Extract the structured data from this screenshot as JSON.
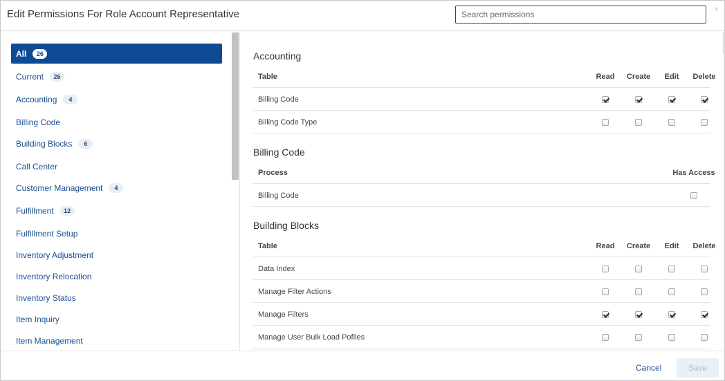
{
  "header": {
    "title": "Edit Permissions For Role Account Representative",
    "search_placeholder": "Search permissions",
    "search_value": "",
    "close_glyph": "×"
  },
  "sidebar": {
    "items": [
      {
        "label": "All",
        "count": "26",
        "active": true
      },
      {
        "label": "Current",
        "count": "26"
      },
      {
        "label": "Accounting",
        "count": "4"
      },
      {
        "label": "Billing Code",
        "count": ""
      },
      {
        "label": "Building Blocks",
        "count": "6"
      },
      {
        "label": "Call Center",
        "count": ""
      },
      {
        "label": "Customer Management",
        "count": "4"
      },
      {
        "label": "Fulfillment",
        "count": "12"
      },
      {
        "label": "Fulfillment Setup",
        "count": ""
      },
      {
        "label": "Inventory Adjustment",
        "count": ""
      },
      {
        "label": "Inventory Relocation",
        "count": ""
      },
      {
        "label": "Inventory Status",
        "count": ""
      },
      {
        "label": "Item Inquiry",
        "count": ""
      },
      {
        "label": "Item Management",
        "count": ""
      }
    ]
  },
  "sections": [
    {
      "title": "Accounting",
      "kind": "table",
      "headers": {
        "name": "Table",
        "read": "Read",
        "create": "Create",
        "edit": "Edit",
        "delete": "Delete"
      },
      "rows": [
        {
          "name": "Billing Code",
          "read": true,
          "create": true,
          "edit": true,
          "delete": true
        },
        {
          "name": "Billing Code Type",
          "read": false,
          "create": false,
          "edit": false,
          "delete": false
        }
      ]
    },
    {
      "title": "Billing Code",
      "kind": "process",
      "headers": {
        "name": "Process",
        "access": "Has Access"
      },
      "rows": [
        {
          "name": "Billing Code",
          "access": false
        }
      ]
    },
    {
      "title": "Building Blocks",
      "kind": "table",
      "headers": {
        "name": "Table",
        "read": "Read",
        "create": "Create",
        "edit": "Edit",
        "delete": "Delete"
      },
      "rows": [
        {
          "name": "Data Index",
          "read": false,
          "create": false,
          "edit": false,
          "delete": false
        },
        {
          "name": "Manage Filter Actions",
          "read": false,
          "create": false,
          "edit": false,
          "delete": false
        },
        {
          "name": "Manage Filters",
          "read": true,
          "create": true,
          "edit": true,
          "delete": true
        },
        {
          "name": "Manage User Bulk Load Pofiles",
          "read": false,
          "create": false,
          "edit": false,
          "delete": false
        }
      ]
    }
  ],
  "footer": {
    "cancel_label": "Cancel",
    "save_label": "Save"
  },
  "colors": {
    "accent": "#0f4a94",
    "link": "#1a4f8f",
    "border": "#e2e2e2"
  }
}
